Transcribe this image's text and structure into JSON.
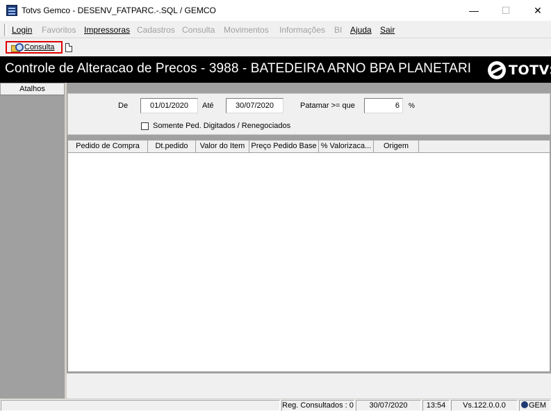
{
  "window": {
    "title": "Totvs Gemco - DESENV_FATPARC.-.SQL / GEMCO",
    "minimize": "—",
    "maximize": "☐",
    "close": "✕"
  },
  "menu": [
    {
      "label": "Login",
      "disabled": false
    },
    {
      "label": "Favoritos",
      "disabled": true
    },
    {
      "label": "Impressoras",
      "disabled": false
    },
    {
      "label": "Cadastros",
      "disabled": true
    },
    {
      "label": "Consulta",
      "disabled": true
    },
    {
      "label": "Movimentos",
      "disabled": true
    },
    {
      "label": "Informações",
      "disabled": true
    },
    {
      "label": "BI",
      "disabled": true
    },
    {
      "label": "Ajuda",
      "disabled": false
    },
    {
      "label": "Sair",
      "disabled": false
    }
  ],
  "toolbar": {
    "consulta_label": "Consulta"
  },
  "banner": {
    "title": "Controle de Alteracao de Precos  - 3988 - BATEDEIRA ARNO BPA PLANETARI",
    "logo_text": "TOTVS"
  },
  "sidebar": {
    "header": "Atalhos"
  },
  "filters": {
    "de_label": "De",
    "de_value": "01/01/2020",
    "ate_label": "Até",
    "ate_value": "30/07/2020",
    "patamar_label": "Patamar >= que",
    "patamar_value": "6",
    "percent_label": "%",
    "checkbox_label": "Somente Ped. Digitados / Renegociados",
    "checkbox_checked": false
  },
  "grid": {
    "columns": [
      "Pedido de Compra",
      "Dt.pedido",
      "Valor do Item",
      "Preço Pedido Base",
      "% Valorizaca...",
      "Origem"
    ],
    "rows": []
  },
  "status": {
    "reg_consultados": "Reg. Consultados : 0",
    "date": "30/07/2020",
    "time": "13:54",
    "version": "Vs.122.0.0.0",
    "app": "GEM"
  },
  "colors": {
    "banner_bg": "#000000",
    "highlight_border": "#e00000",
    "workspace_bg": "#a0a0a0"
  }
}
